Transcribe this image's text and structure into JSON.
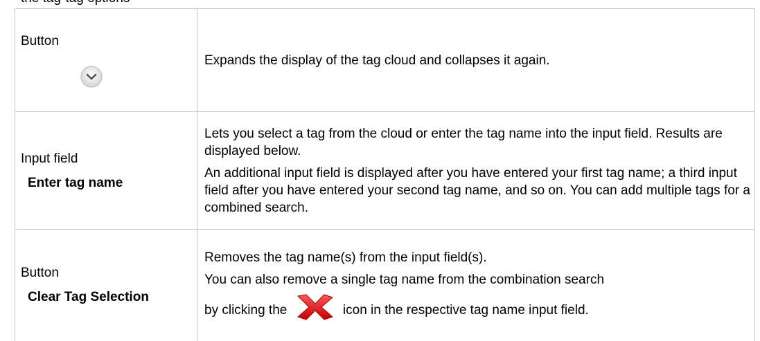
{
  "header_fragment": "the tag-tag options",
  "rows": [
    {
      "element_type": "Button",
      "element_name": "",
      "icon": "chevron-down-circle-icon",
      "description": [
        "Expands the display of the tag cloud and collapses it again."
      ]
    },
    {
      "element_type": "Input field",
      "element_name": "Enter tag name",
      "description": [
        "Lets you select a tag from the cloud or enter the tag name into the input field. Results are displayed below.",
        "An additional input field is displayed after you have entered your first tag name; a third input field after you have entered your second tag name, and so on. You can add multiple tags for a combined search."
      ]
    },
    {
      "element_type": "Button",
      "element_name": "Clear Tag Selection",
      "description": [
        "Removes the tag name(s) from the input field(s).",
        "You can also remove a single tag name from the combination search"
      ],
      "inline_before": "by clicking the",
      "inline_icon": "red-x-icon",
      "inline_after": "icon in the respective tag name input field."
    }
  ],
  "colors": {
    "border": "#c8c8c8",
    "icon_red": "#e11c1c",
    "icon_grey": "#e6e6e6"
  }
}
